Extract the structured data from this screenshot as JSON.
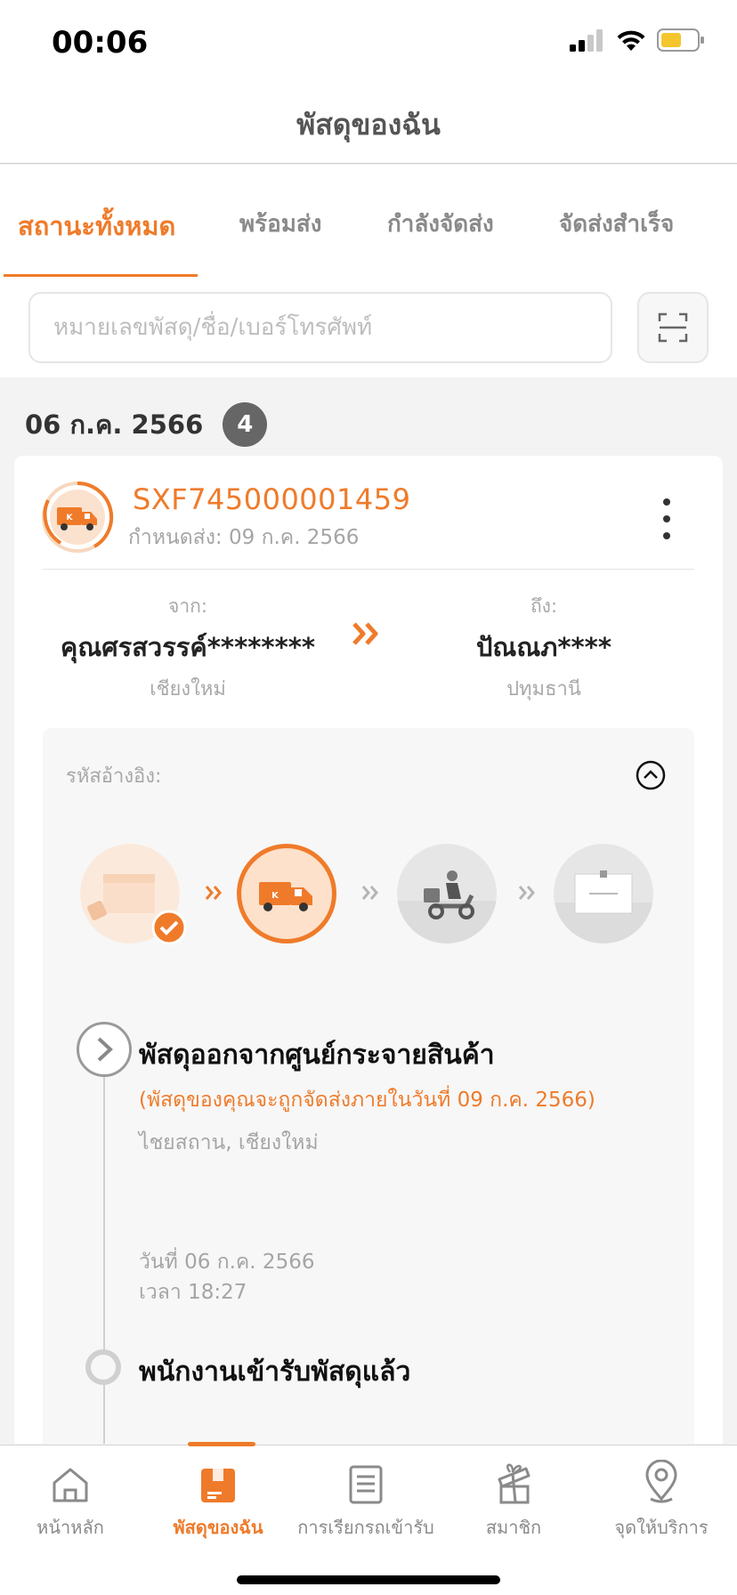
{
  "status_bar": {
    "time": "00:06"
  },
  "header": {
    "title": "พัสดุของฉัน"
  },
  "tabs": [
    {
      "label": "สถานะทั้งหมด",
      "active": true
    },
    {
      "label": "พร้อมส่ง",
      "active": false
    },
    {
      "label": "กำลังจัดส่ง",
      "active": false
    },
    {
      "label": "จัดส่งสำเร็จ",
      "active": false
    }
  ],
  "search": {
    "placeholder": "หมายเลขพัสดุ/ชื่อ/เบอร์โทรศัพท์",
    "value": ""
  },
  "group": {
    "date": "06 ก.ค. 2566",
    "count": "4"
  },
  "parcel": {
    "tracking_number": "SXF745000001459",
    "due_label": "กำหนดส่ง: 09 ก.ค. 2566",
    "from": {
      "label": "จาก:",
      "name": "คุณศรสวรรค์********",
      "city": "เชียงใหม่"
    },
    "to": {
      "label": "ถึง:",
      "name": "ปัณณภ****",
      "city": "ปทุมธานี"
    },
    "reference_label": "รหัสอ้างอิง:",
    "events": [
      {
        "title": "พัสดุออกจากศูนย์กระจายสินค้า",
        "note": "(พัสดุของคุณจะถูกจัดส่งภายในวันที่ 09 ก.ค. 2566)",
        "location": "ไชยสถาน, เชียงใหม่",
        "date": "วันที่ 06 ก.ค. 2566",
        "time": "เวลา 18:27"
      },
      {
        "title": "พนักงานเข้ารับพัสดุแล้ว"
      }
    ]
  },
  "bottom_nav": [
    {
      "label": "หน้าหลัก",
      "icon": "home-icon",
      "active": false
    },
    {
      "label": "พัสดุของฉัน",
      "icon": "parcel-box-icon",
      "active": true
    },
    {
      "label": "การเรียกรถเข้ารับ",
      "icon": "document-list-icon",
      "active": false
    },
    {
      "label": "สมาชิก",
      "icon": "gift-icon",
      "active": false
    },
    {
      "label": "จุดให้บริการ",
      "icon": "map-pin-icon",
      "active": false
    }
  ],
  "colors": {
    "accent": "#ef7b2a",
    "muted": "#a5a5a5"
  }
}
